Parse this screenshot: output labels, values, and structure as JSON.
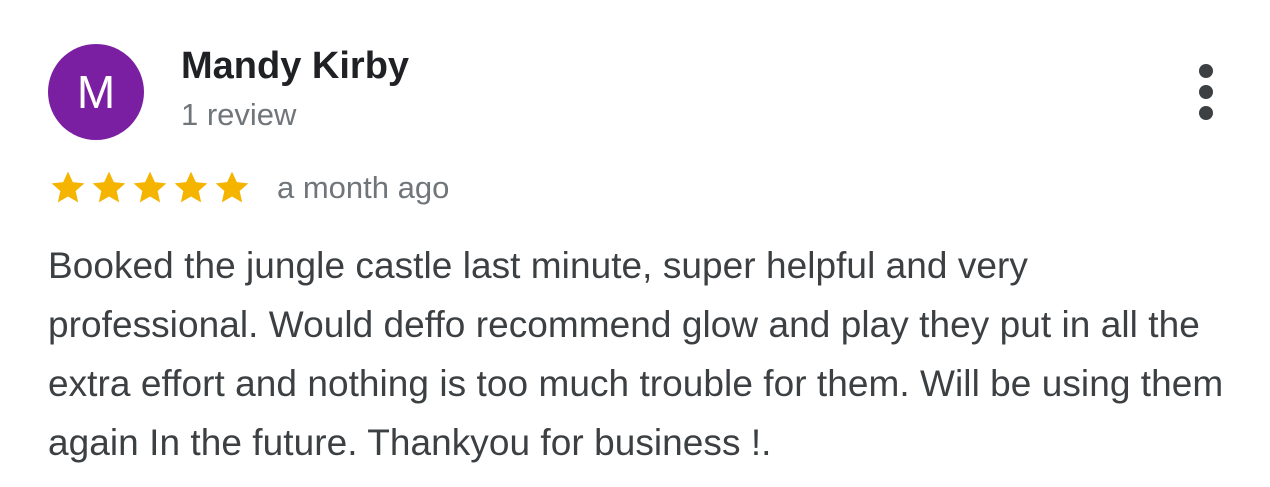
{
  "review": {
    "author_name": "Mandy Kirby",
    "avatar_initial": "M",
    "review_count": "1 review",
    "rating": 5,
    "max_rating": 5,
    "time_ago": "a month ago",
    "text": "Booked the jungle castle last minute, super helpful and very professional. Would deffo recommend glow and play they put in all the extra effort and nothing is too much trouble for them. Will be using them again In the future. Thankyou for business !."
  },
  "icons": {
    "more": "more-vertical-icon",
    "star": "star-icon"
  },
  "colors": {
    "avatar_bg": "#7b1fa2",
    "star": "#f4b400",
    "secondary_text": "#70757a",
    "body_text": "#3c4043"
  }
}
